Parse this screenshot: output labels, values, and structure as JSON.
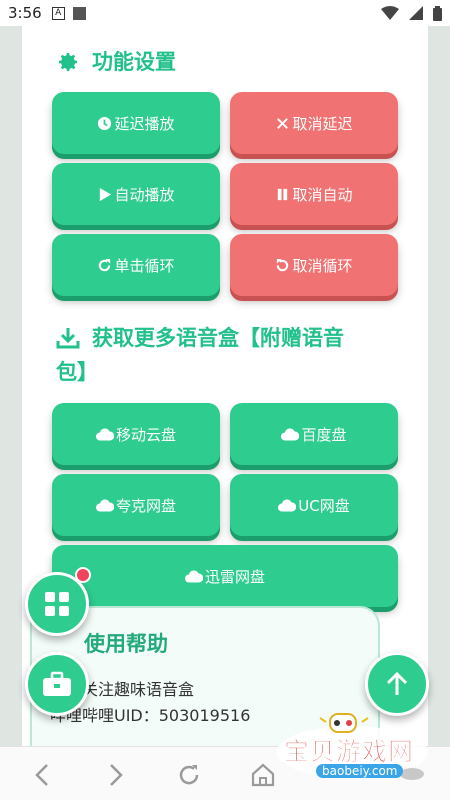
{
  "status_bar": {
    "time": "3:56",
    "notif_letter": "A"
  },
  "settings": {
    "title": "功能设置",
    "buttons": [
      {
        "label": "延迟播放",
        "icon": "clock-icon",
        "color": "#2ecc8f"
      },
      {
        "label": "取消延迟",
        "icon": "x-icon",
        "color": "#f07272"
      },
      {
        "label": "自动播放",
        "icon": "play-icon",
        "color": "#2ecc8f"
      },
      {
        "label": "取消自动",
        "icon": "pause-icon",
        "color": "#f07272"
      },
      {
        "label": "单击循环",
        "icon": "redo-icon",
        "color": "#2ecc8f"
      },
      {
        "label": "取消循环",
        "icon": "undo-icon",
        "color": "#f07272"
      }
    ]
  },
  "download": {
    "title_line1": "获取更多语音盒【附赠语音",
    "title_line2": "包】",
    "buttons": [
      {
        "label": "移动云盘",
        "icon": "cloud-icon"
      },
      {
        "label": "百度盘",
        "icon": "cloud-icon"
      },
      {
        "label": "夸克网盘",
        "icon": "cloud-icon"
      },
      {
        "label": "UC网盘",
        "icon": "cloud-icon"
      },
      {
        "label": "迅雷网盘",
        "icon": "cloud-icon"
      }
    ]
  },
  "help": {
    "title": "使用帮助",
    "line1": "欢迎关注趣味语音盒",
    "line2": "哔哩哔哩UID：503019516"
  },
  "watermark": {
    "text": "宝贝游戏网",
    "url": "baobeiy.com"
  }
}
